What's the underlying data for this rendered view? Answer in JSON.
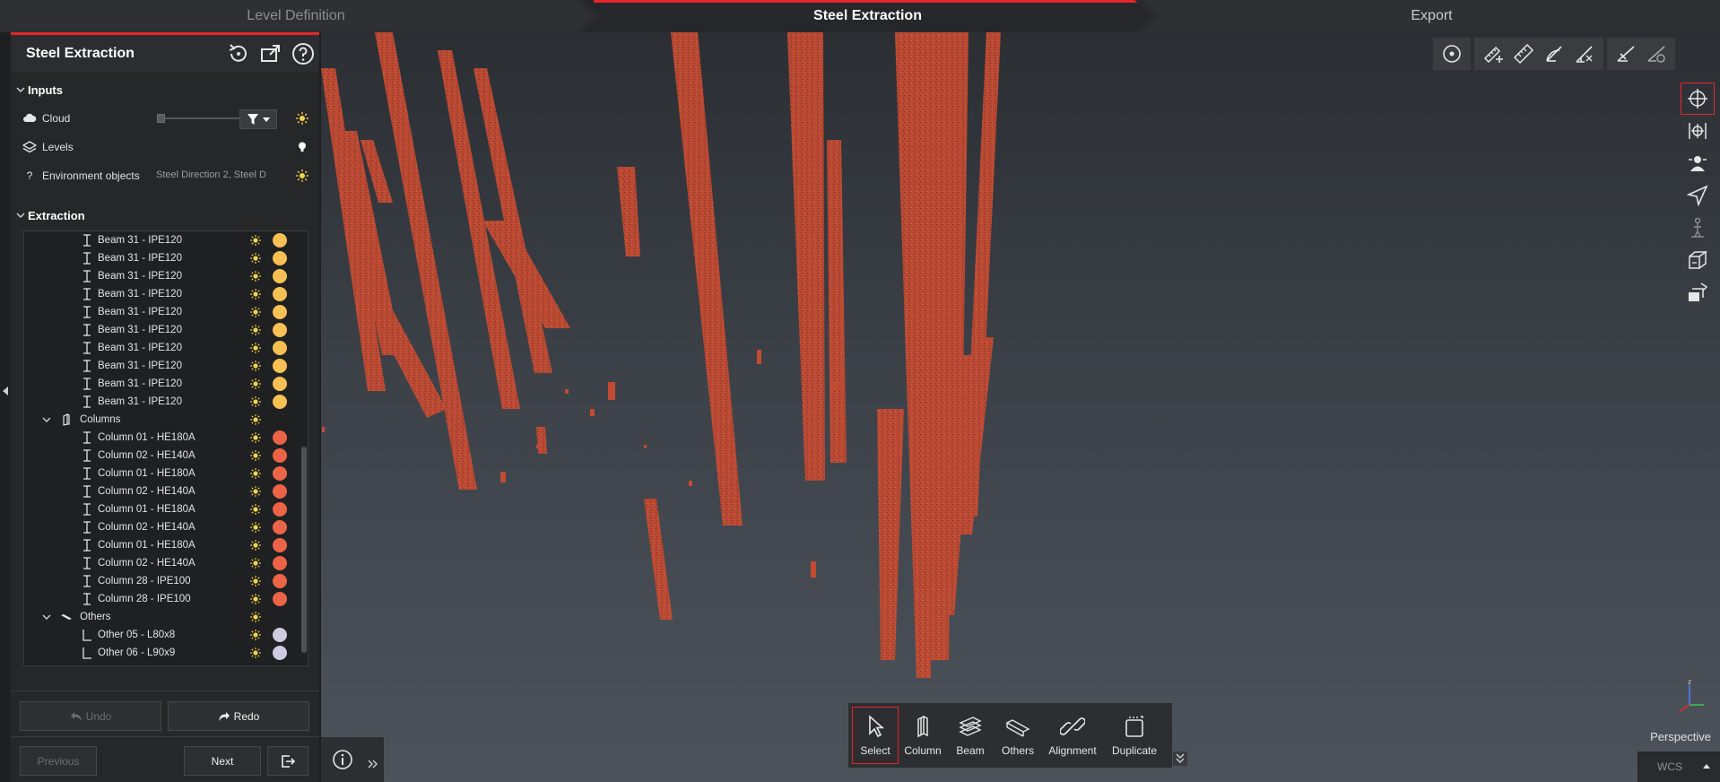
{
  "workflow_tabs": [
    {
      "label": "Level Definition",
      "state": "inactive"
    },
    {
      "label": "Steel Extraction",
      "state": "active"
    },
    {
      "label": "Export",
      "state": "inactive"
    }
  ],
  "panel": {
    "title": "Steel Extraction",
    "inputs": {
      "heading": "Inputs",
      "cloud_label": "Cloud",
      "levels_label": "Levels",
      "env_label": "Environment objects",
      "env_value": "Steel Direction 2, Steel D"
    },
    "extraction": {
      "heading": "Extraction",
      "beams": [
        "Beam 31 - IPE120",
        "Beam 31 - IPE120",
        "Beam 31 - IPE120",
        "Beam 31 - IPE120",
        "Beam 31 - IPE120",
        "Beam 31 - IPE120",
        "Beam 31 - IPE120",
        "Beam 31 - IPE120",
        "Beam 31 - IPE120",
        "Beam 31 - IPE120"
      ],
      "columns_group": "Columns",
      "columns": [
        "Column 01 - HE180A",
        "Column 02 - HE140A",
        "Column 01 - HE180A",
        "Column 02 - HE140A",
        "Column 01 - HE180A",
        "Column 02 - HE140A",
        "Column 01 - HE180A",
        "Column 02 - HE140A",
        "Column 28 - IPE100",
        "Column 28 - IPE100"
      ],
      "others_group": "Others",
      "others": [
        "Other 05 - L80x8",
        "Other 06 - L90x9"
      ]
    },
    "undo_label": "Undo",
    "redo_label": "Redo",
    "previous_label": "Previous",
    "next_label": "Next"
  },
  "bottom_tools": [
    {
      "label": "Select",
      "icon": "cursor-icon"
    },
    {
      "label": "Column",
      "icon": "column-icon"
    },
    {
      "label": "Beam",
      "icon": "beam-icon"
    },
    {
      "label": "Others",
      "icon": "others-icon"
    },
    {
      "label": "Alignment",
      "icon": "link-icon"
    },
    {
      "label": "Duplicate",
      "icon": "duplicate-icon"
    }
  ],
  "view": {
    "projection": "Perspective",
    "coord_system": "WCS"
  },
  "colors": {
    "accent": "#e8242c",
    "beam": "#f7c055",
    "column": "#ec6447",
    "other": "#cfcbe0",
    "point_cloud": "#c24b33"
  }
}
